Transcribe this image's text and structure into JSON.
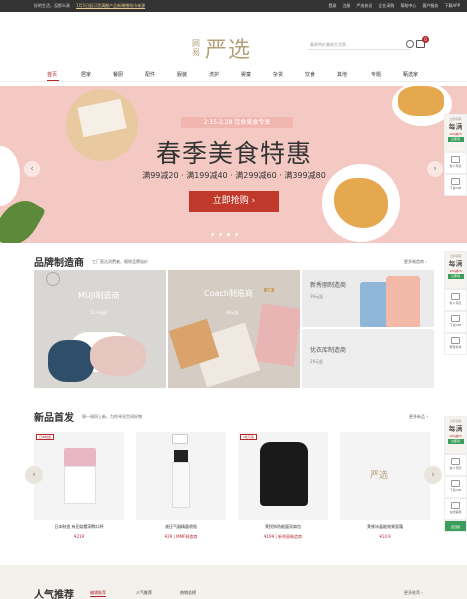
{
  "topbar": {
    "left": [
      "好的生活，没那么贵"
    ],
    "promo": "1月5日起订货满额产品新赠赠纸巾来源",
    "right": [
      "登录",
      "注册",
      "严选协议",
      "企业采购",
      "帮助中心",
      "客户服务",
      "下载APP"
    ]
  },
  "header": {
    "logo_small": "网易",
    "logo_big": "严选",
    "search_placeholder": "春季特价美味生活季",
    "cart_count": "0"
  },
  "nav": {
    "items": [
      "首页",
      "居家",
      "餐厨",
      "配件",
      "服装",
      "洗护",
      "婴童",
      "杂货",
      "饮食",
      "其他",
      "专题",
      "甄选家"
    ]
  },
  "banner": {
    "date": "2.15-2.28 饮食美食专享",
    "headline": "春季美食特惠",
    "offers": "满99减20 · 满199减40 · 满299减60 · 满399减80",
    "cta": "立即抢购 ›",
    "arrow_left": "‹",
    "arrow_right": "›"
  },
  "sidebar": {
    "promo_t1": "立即领取",
    "promo_t2": "每满",
    "promo_t3": "100减25",
    "promo_t4": "立即领",
    "items": [
      "新人专区",
      "下载APP",
      "在线客服",
      "帮我寻找"
    ],
    "top": "回顶部"
  },
  "brand": {
    "title": "品牌制造商",
    "subtitle": "工厂直达消费者，剔除品牌溢价",
    "more": "更多制造商 ›",
    "cards": [
      {
        "label": "MUJI制造商",
        "price": "12.9元起"
      },
      {
        "label": "Coach制造商",
        "price": "49元起",
        "badge": "上新"
      },
      {
        "label": "新秀丽制造商",
        "price": "39元起"
      },
      {
        "label": "优衣库制造商",
        "price": "29元起"
      }
    ]
  },
  "newarrivals": {
    "title": "新品首发",
    "subtitle": "周一周四上新，为你寻觅世间好物",
    "more": "更多新品 ›",
    "arrow_left": "‹",
    "arrow_right": "›",
    "items": [
      {
        "tag": "日本制造",
        "name": "日本制造 有田烧樱洞陶口杯",
        "price": "¥219"
      },
      {
        "tag": "",
        "name": "液压气烟精量喷瓶",
        "price": "¥29 | MMF制造商"
      },
      {
        "tag": "3色可选",
        "name": "莱悦饰防能量双肩包",
        "price": "¥199 | 新秀丽制造商"
      },
      {
        "tag": "",
        "name": "莱顿冰晶能效果面霜",
        "price": "¥14.9"
      }
    ]
  },
  "popular": {
    "title": "人气推荐",
    "tabs": [
      "编辑推荐",
      "人气推荐",
      "热销总榜"
    ],
    "more": "更多推荐 ›"
  }
}
